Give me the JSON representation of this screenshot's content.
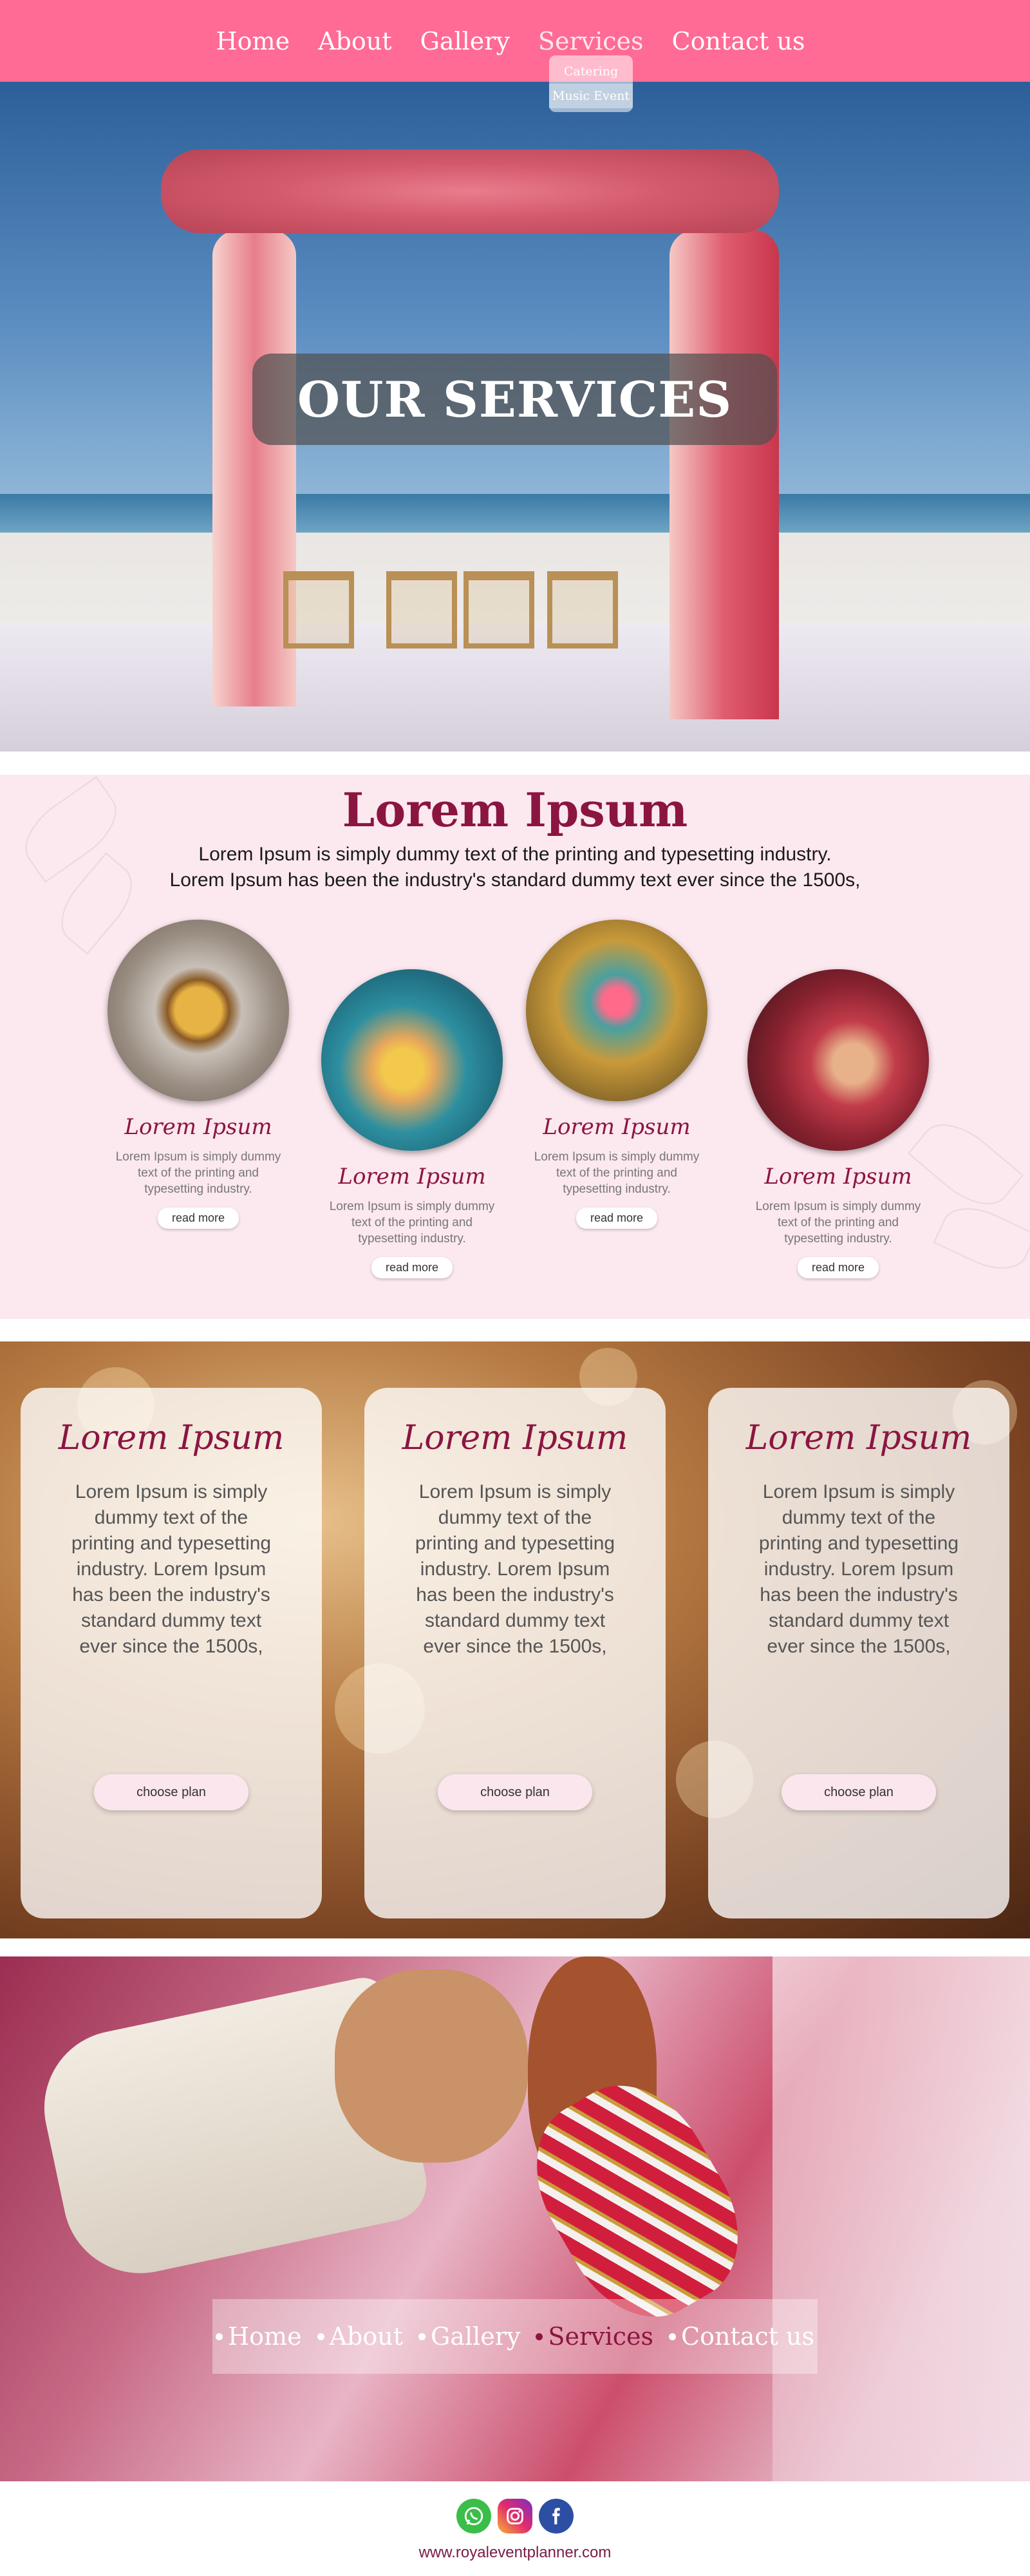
{
  "nav": {
    "items": [
      {
        "label": "Home"
      },
      {
        "label": "About"
      },
      {
        "label": "Gallery"
      },
      {
        "label": "Services"
      },
      {
        "label": "Contact us"
      }
    ],
    "active": "Services",
    "dropdown": [
      {
        "label": "Catering"
      },
      {
        "label": "Music Event"
      }
    ]
  },
  "hero": {
    "title": "OUR SERVICES"
  },
  "intro": {
    "title": "Lorem Ipsum",
    "text_line1": "Lorem Ipsum is simply dummy text of the printing and typesetting industry.",
    "text_line2": "Lorem Ipsum has been the industry's standard dummy text ever since the 1500s,",
    "cards": [
      {
        "title": "Lorem Ipsum",
        "text": "Lorem Ipsum is simply dummy text of the printing and typesetting industry.",
        "button": "read more",
        "image": "rings-photo"
      },
      {
        "title": "Lorem Ipsum",
        "text": "Lorem Ipsum is simply dummy text of the printing and typesetting industry.",
        "button": "read more",
        "image": "haldi-ceremony-photo"
      },
      {
        "title": "Lorem Ipsum",
        "text": "Lorem Ipsum is simply dummy text of the printing and typesetting industry.",
        "button": "read more",
        "image": "lanterns-decor-photo"
      },
      {
        "title": "Lorem Ipsum",
        "text": "Lorem Ipsum is simply dummy text of the printing and typesetting industry.",
        "button": "read more",
        "image": "bride-groom-photo"
      }
    ]
  },
  "plans": [
    {
      "title": "Lorem Ipsum",
      "text": "Lorem Ipsum is simply dummy text of the printing and typesetting industry. Lorem Ipsum has been the industry's standard dummy text ever since the 1500s,",
      "button": "choose plan"
    },
    {
      "title": "Lorem Ipsum",
      "text": "Lorem Ipsum is simply dummy text of the printing and typesetting industry. Lorem Ipsum has been the industry's standard dummy text ever since the 1500s,",
      "button": "choose plan"
    },
    {
      "title": "Lorem Ipsum",
      "text": "Lorem Ipsum is simply dummy text of the printing and typesetting industry. Lorem Ipsum has been the industry's standard dummy text ever since the 1500s,",
      "button": "choose plan"
    }
  ],
  "footer_nav": {
    "items": [
      {
        "label": "Home"
      },
      {
        "label": "About"
      },
      {
        "label": "Gallery"
      },
      {
        "label": "Services"
      },
      {
        "label": "Contact us"
      }
    ]
  },
  "social": {
    "icons": [
      "whatsapp-icon",
      "instagram-icon",
      "facebook-icon"
    ]
  },
  "site_url": "www.royaleventplanner.com",
  "colors": {
    "nav_bg": "#ff6b94",
    "accent": "#8b1541",
    "section_bg": "#fce8ef"
  }
}
